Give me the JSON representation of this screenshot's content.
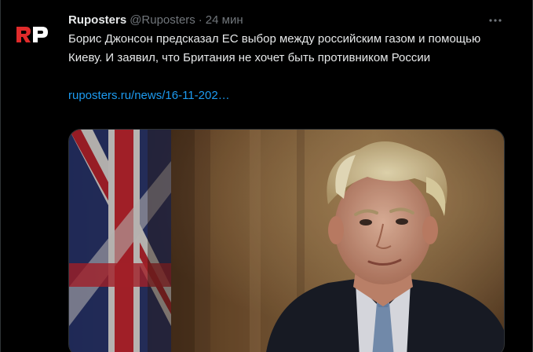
{
  "tweet": {
    "author_name": "Ruposters",
    "handle": "@Ruposters",
    "separator": "·",
    "time": "24 мин",
    "text": "Борис Джонсон предсказал ЕС выбор между российским газом и помощью Киеву. И заявил, что Британия не хочет быть противником России",
    "link_text": "ruposters.ru/news/16-11-202…"
  },
  "avatar": {
    "logo_text": "RP",
    "colors": {
      "r": "#e02b2b",
      "p": "#ffffff"
    }
  },
  "icons": {
    "more": "more-horizontal-icon"
  },
  "colors": {
    "background": "#000000",
    "primary_text": "#e7e9ea",
    "secondary_text": "#71767b",
    "link": "#1d9bf0",
    "border": "#2f3336"
  }
}
